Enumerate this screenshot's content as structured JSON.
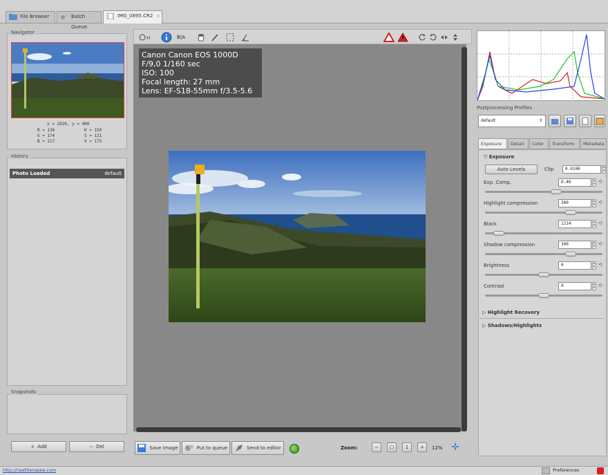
{
  "tabs": [
    {
      "label": "File Browser"
    },
    {
      "label": "Batch Queue"
    },
    {
      "label": "IMG_0895.CR2"
    }
  ],
  "tab_close_icon": "×",
  "left": {
    "navigator_title": "Navigator",
    "coords": "x = 2920, y = 400",
    "rgb": {
      "r": "R = 136",
      "g": "G = 174",
      "b": "B = 217"
    },
    "hsv": {
      "h": "H = 150",
      "s": "S = 131",
      "v": "V = 175"
    },
    "history_title": "History",
    "history_items": [
      {
        "name": "Photo Loaded",
        "profile": "default"
      }
    ],
    "snapshots_title": "Snapshots",
    "add_label": "Add",
    "del_label": "Del"
  },
  "toolbar": {
    "before_after": "B|A"
  },
  "exif": {
    "line1": "Canon Canon EOS 1000D",
    "line2": "F/9,0 1/160 sec",
    "line3": "ISO: 100",
    "line4": "Focal length: 27 mm",
    "line5": "Lens: EF-S18-55mm f/3.5-5.6"
  },
  "bottom": {
    "save_label": "Save image",
    "queue_label": "Put to queue",
    "editor_label": "Send to editor",
    "zoom_label": "Zoom:",
    "zoom_value": "12%"
  },
  "right": {
    "profiles_title": "Postprocessing Profiles",
    "profile_value": "default",
    "tabs": [
      "Exposure",
      "Detail",
      "Color",
      "Transform",
      "Metadata"
    ],
    "exposure_header": "Exposure",
    "auto_levels": "Auto Levels",
    "clip_label": "Clip",
    "clip_value": "0.0100",
    "params": [
      {
        "label": "Exp. Comp.",
        "value": "0.46",
        "level": 0.62
      },
      {
        "label": "Highlight compression",
        "value": "300",
        "level": 0.75
      },
      {
        "label": "Black",
        "value": "1214",
        "level": 0.08
      },
      {
        "label": "Shadow compression",
        "value": "300",
        "level": 0.75
      },
      {
        "label": "Brightness",
        "value": "0",
        "level": 0.5
      },
      {
        "label": "Contrast",
        "value": "0",
        "level": 0.5
      }
    ],
    "highlight_recovery": "Highlight Recovery",
    "shadows_highlights": "Shadows/Highlights"
  },
  "status": {
    "url": "http://rawtherapee.com",
    "preferences": "Preferences"
  },
  "colors": {
    "accent": "#3a6fc0",
    "history_selected": "#555555",
    "warn_red": "#d42020"
  }
}
